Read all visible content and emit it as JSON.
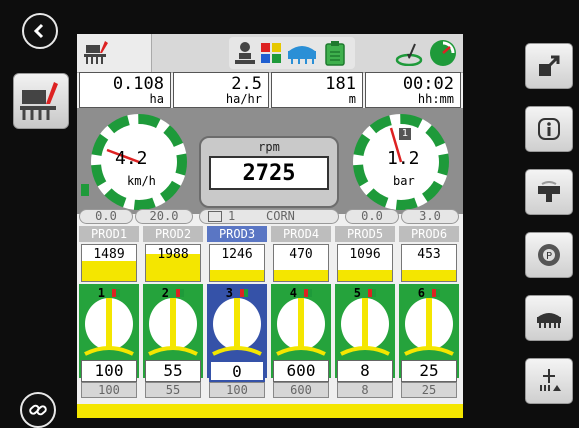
{
  "stats": [
    {
      "value": "0.108",
      "unit": "ha"
    },
    {
      "value": "2.5",
      "unit": "ha/hr"
    },
    {
      "value": "181",
      "unit": "m"
    },
    {
      "value": "00:02",
      "unit": "hh:mm"
    }
  ],
  "speed": {
    "value": "4.2",
    "unit": "km/h"
  },
  "rpm": {
    "label": "rpm",
    "value": "2725"
  },
  "pressure": {
    "value": "1.2",
    "unit": "bar",
    "badge": "1"
  },
  "pills": {
    "speed_min": "0.0",
    "speed_max": "20.0",
    "section": "1",
    "crop": "CORN",
    "press_min": "0.0",
    "press_max": "3.0"
  },
  "products": [
    {
      "label": "PROD1",
      "rate": "1489",
      "fill": 0.55,
      "row": "1",
      "target": "100",
      "actual": "100"
    },
    {
      "label": "PROD2",
      "rate": "1988",
      "fill": 0.75,
      "row": "2",
      "target": "55",
      "actual": "55"
    },
    {
      "label": "PROD3",
      "rate": "1246",
      "fill": 0.3,
      "row": "3",
      "target": "0",
      "actual": "100"
    },
    {
      "label": "PROD4",
      "rate": "470",
      "fill": 0.3,
      "row": "4",
      "target": "600",
      "actual": "600"
    },
    {
      "label": "PROD5",
      "rate": "1096",
      "fill": 0.3,
      "row": "5",
      "target": "8",
      "actual": "8"
    },
    {
      "label": "PROD6",
      "rate": "453",
      "fill": 0.3,
      "row": "6",
      "target": "25",
      "actual": "25"
    }
  ],
  "colors": {
    "green": "#1e9a3a",
    "yellow": "#f4e600",
    "selected": "#3552a8"
  }
}
